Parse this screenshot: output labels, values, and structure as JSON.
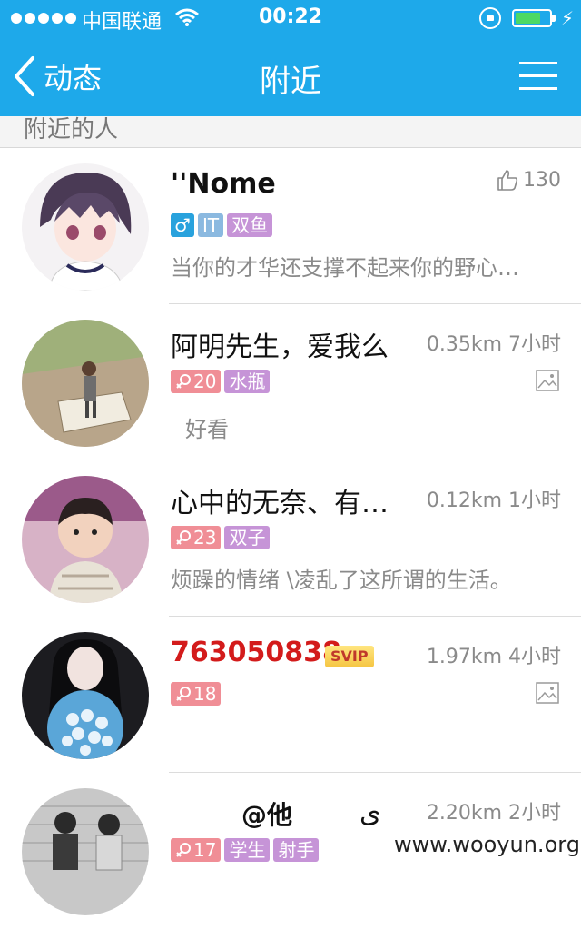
{
  "status_bar": {
    "carrier": "中国联通",
    "time": "00:22",
    "battery_level": 0.75,
    "colors": {
      "background": "#1ea9ea",
      "battery": "#4cd964"
    },
    "icons": [
      "signal-dots",
      "wifi-icon",
      "rotation-lock-icon",
      "battery-icon",
      "charging-bolt-icon"
    ]
  },
  "nav": {
    "back_label": "动态",
    "title": "附近",
    "icons": [
      "back-chevron-icon",
      "menu-icon"
    ]
  },
  "section_header": "附近的人",
  "people": [
    {
      "name": "''Nome",
      "likes": "130",
      "gender_symbol": "♂",
      "tags": [
        "IT",
        "双鱼"
      ],
      "signature": "当你的才华还支撑不起来你的野心…"
    },
    {
      "name": "阿明先生，爱我么",
      "distance": "0.35km",
      "time_ago": "7小时",
      "female_age": "20",
      "tags": [
        "水瓶"
      ],
      "signature": "好看",
      "has_photo": true
    },
    {
      "name": "心中的无奈、有…",
      "distance": "0.12km",
      "time_ago": "1小时",
      "female_age": "23",
      "tags": [
        "双子"
      ],
      "signature": "烦躁的情绪 \\凌乱了这所谓的生活。"
    },
    {
      "name": "763050838",
      "vip_badge": "SVIP",
      "distance": "1.97km",
      "time_ago": "4小时",
      "female_age": "18",
      "tags": [],
      "has_photo": true
    },
    {
      "name": "",
      "distance": "2.20km",
      "time_ago": "2小时",
      "female_age": "17",
      "tags": [
        "学生",
        "射手"
      ]
    }
  ],
  "overlay": {
    "at_text": "@他",
    "glyph": "ى",
    "watermark": "www.wooyun.org"
  }
}
